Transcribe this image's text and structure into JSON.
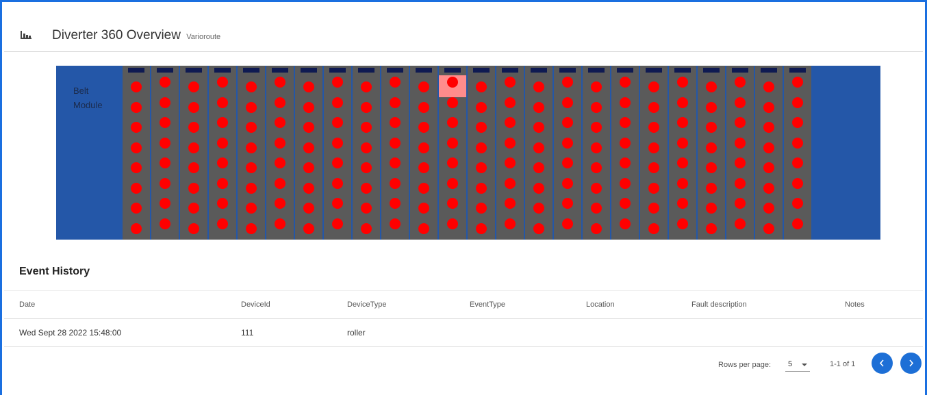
{
  "header": {
    "title": "Diverter 360 Overview",
    "subtitle": "Varioroute",
    "icon": "bar-chart-icon"
  },
  "diagram": {
    "belt_label_line1": "Belt",
    "belt_label_line2": "Module",
    "module_count": 24,
    "dots_per_module": 8,
    "highlighted_module": 11,
    "colors": {
      "belt": "#2457a8",
      "module": "#5a5a5a",
      "cap": "#0f1a52",
      "dot": "#ff0000",
      "highlight": "#ff8c8c"
    }
  },
  "event_history": {
    "title": "Event History",
    "columns": [
      "Date",
      "DeviceId",
      "DeviceType",
      "EventType",
      "Location",
      "Fault description",
      "Notes"
    ],
    "rows": [
      {
        "date": "Wed Sept 28 2022 15:48:00",
        "device_id": "111",
        "device_type": "roller",
        "event_type": "",
        "location": "",
        "fault_description": "",
        "notes": ""
      }
    ]
  },
  "pagination": {
    "rows_per_page_label": "Rows per page:",
    "rows_per_page_value": "5",
    "range": "1-1 of 1",
    "prev_icon": "chevron-left-icon",
    "next_icon": "chevron-right-icon",
    "accent": "#1d6fd6"
  }
}
